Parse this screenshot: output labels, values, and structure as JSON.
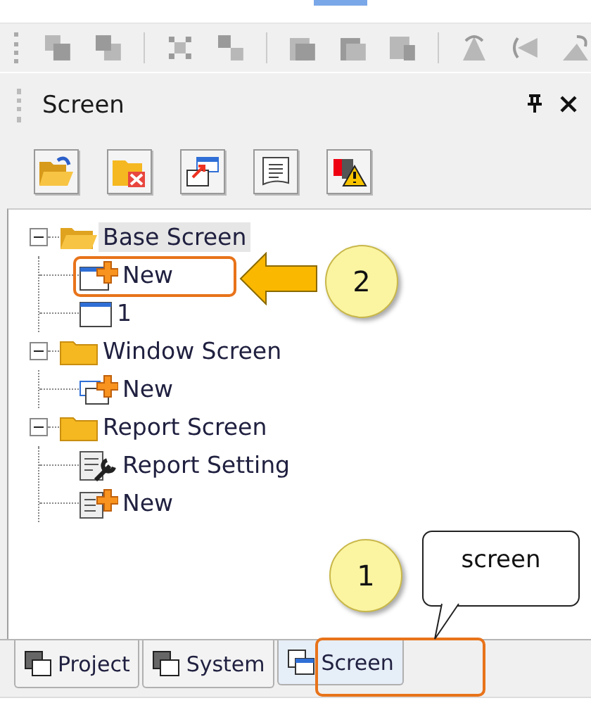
{
  "panel": {
    "title": "Screen"
  },
  "tree": [
    {
      "label": "Base Screen",
      "kind": "folder-open",
      "expanded": true,
      "selected": true,
      "children": [
        {
          "label": "New",
          "kind": "new-screen",
          "selected": false
        },
        {
          "label": "1",
          "kind": "screen",
          "selected": false
        }
      ]
    },
    {
      "label": "Window Screen",
      "kind": "folder",
      "expanded": true,
      "selected": false,
      "children": [
        {
          "label": "New",
          "kind": "new-window",
          "selected": false
        }
      ]
    },
    {
      "label": "Report Screen",
      "kind": "folder",
      "expanded": true,
      "selected": false,
      "children": [
        {
          "label": "Report Setting",
          "kind": "report-setting",
          "selected": false
        },
        {
          "label": "New",
          "kind": "new-report",
          "selected": false
        }
      ]
    }
  ],
  "tabs": [
    {
      "label": "Project",
      "selected": false
    },
    {
      "label": "System",
      "selected": false
    },
    {
      "label": "Screen",
      "selected": true
    }
  ],
  "annotations": [
    {
      "kind": "marker",
      "text": "2"
    },
    {
      "kind": "marker",
      "text": "1"
    },
    {
      "kind": "bubble",
      "text": "screen"
    }
  ]
}
